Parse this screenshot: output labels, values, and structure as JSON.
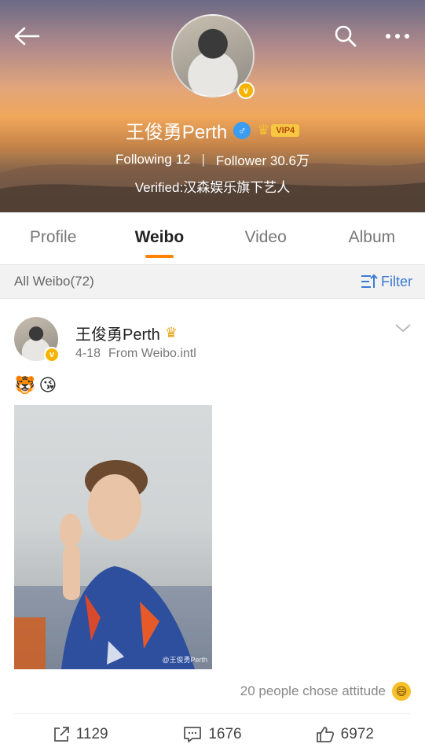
{
  "profile": {
    "name": "王俊勇Perth",
    "gender_symbol": "♂",
    "vip_label": "VIP4",
    "following_label": "Following",
    "following_count": "12",
    "follower_label": "Follower",
    "follower_count": "30.6万",
    "separator": "|",
    "verified_text": "Verified:汉森娱乐旗下艺人",
    "verified_mark": "v"
  },
  "tabs": [
    {
      "label": "Profile",
      "active": false
    },
    {
      "label": "Weibo",
      "active": true
    },
    {
      "label": "Video",
      "active": false
    },
    {
      "label": "Album",
      "active": false
    }
  ],
  "filter_bar": {
    "count_text": "All Weibo(72)",
    "filter_label": "Filter"
  },
  "post": {
    "author": "王俊勇Perth",
    "date": "4-18",
    "source": "From Weibo.intl",
    "emojis": [
      "🐯",
      "😘"
    ],
    "watermark": "@王俊勇Perth",
    "attitude_text": "20 people chose attitude",
    "attitude_emoji": "😄",
    "repost_count": "1129",
    "comment_count": "1676",
    "like_count": "6972"
  },
  "colors": {
    "accent_orange": "#ff8200",
    "link_blue": "#3a7bd5",
    "verified_gold": "#f6b400",
    "vip_gold": "#f7c742"
  },
  "icons": [
    "back-arrow-icon",
    "search-icon",
    "more-icon",
    "chevron-down-icon",
    "filter-icon",
    "repost-icon",
    "comment-icon",
    "like-icon"
  ]
}
